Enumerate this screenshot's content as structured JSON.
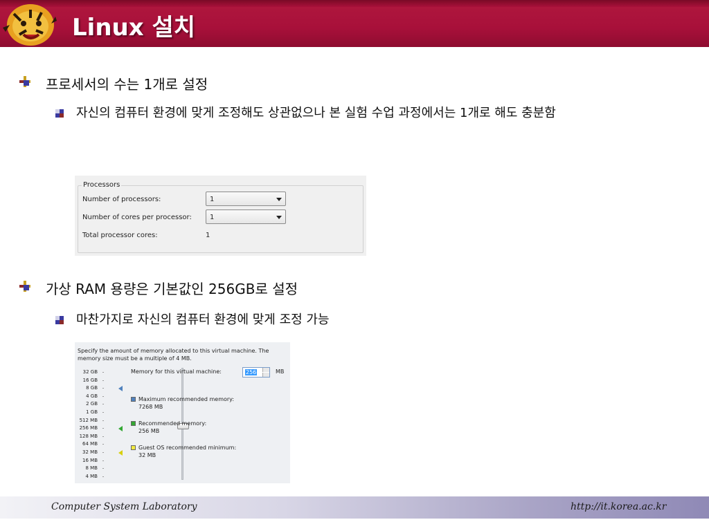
{
  "slide": {
    "title": "Linux 설치"
  },
  "bullets": [
    {
      "text": "프로세서의 수는 1개로 설정",
      "sub": "자신의 컴퓨터 환경에 맞게 조정해도 상관없으나 본 실험 수업 과정에서는 1개로 해도 충분함"
    },
    {
      "text": "가상 RAM 용량은 기본값인 256GB로 설정",
      "sub": "마찬가지로 자신의 컴퓨터 환경에 맞게 조정 가능"
    }
  ],
  "processors_panel": {
    "group_title": "Processors",
    "num_processors_label": "Number of processors:",
    "num_processors_value": "1",
    "cores_label": "Number of cores per processor:",
    "cores_value": "1",
    "total_label": "Total processor cores:",
    "total_value": "1"
  },
  "memory_panel": {
    "description": "Specify the amount of memory allocated to this virtual machine. The memory size must be a multiple of 4 MB.",
    "memory_label": "Memory for this virtual machine:",
    "memory_value": "256",
    "memory_unit": "MB",
    "scale": [
      "32 GB",
      "16 GB",
      "8 GB",
      "4 GB",
      "2 GB",
      "1 GB",
      "512 MB",
      "256 MB",
      "128 MB",
      "64 MB",
      "32 MB",
      "16 MB",
      "8 MB",
      "4 MB"
    ],
    "max_recommended_label": "Maximum recommended memory:",
    "max_recommended_value": "7268 MB",
    "recommended_label": "Recommended memory:",
    "recommended_value": "256 MB",
    "guest_min_label": "Guest OS recommended minimum:",
    "guest_min_value": "32 MB",
    "colors": {
      "max": "#4f81bd",
      "recommended": "#33a833",
      "guest_min": "#e8e020"
    }
  },
  "footer": {
    "left": "Computer System Laboratory",
    "right": "http://it.korea.ac.kr"
  }
}
